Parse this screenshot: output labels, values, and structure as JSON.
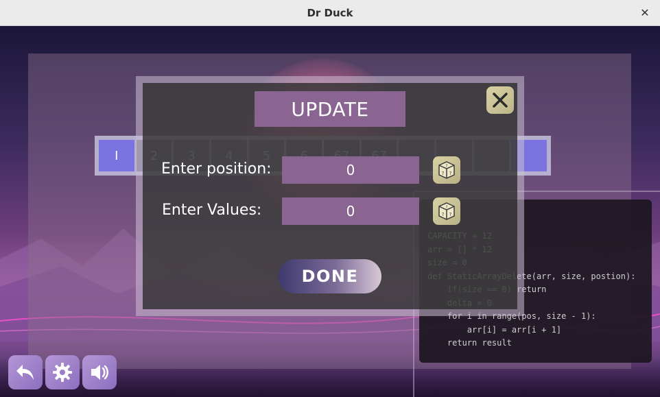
{
  "window": {
    "title": "Dr Duck",
    "close_symbol": "✕"
  },
  "array": {
    "cells": [
      "I",
      "2",
      "3",
      "4",
      "5",
      "6",
      "67",
      "67",
      "",
      "",
      "",
      ""
    ],
    "active_index": 0
  },
  "code": {
    "lines": [
      "CAPACITY = 12",
      "arr = [] * 12",
      "size = 0",
      "def StaticArrayDelete(arr, size, postion):",
      "    if(size == 0) return",
      "    delta = 0",
      "    for i in range(pos, size - 1):",
      "        arr[i] = arr[i + 1]",
      "    return result"
    ]
  },
  "modal": {
    "title": "UPDATE",
    "position_label": "Enter position:",
    "position_value": "0",
    "values_label": "Enter Values:",
    "values_value": "0",
    "done_label": "DONE"
  },
  "icons": {
    "close": "close-icon",
    "dice": "dice-icon",
    "back": "back-arrow-icon",
    "settings": "gear-icon",
    "sound": "speaker-icon"
  },
  "colors": {
    "field_bg": "#8a6592",
    "active_cell": "#7b74e0",
    "icon_button": "#d9d2a4",
    "bottom_button": "#b596d6"
  }
}
